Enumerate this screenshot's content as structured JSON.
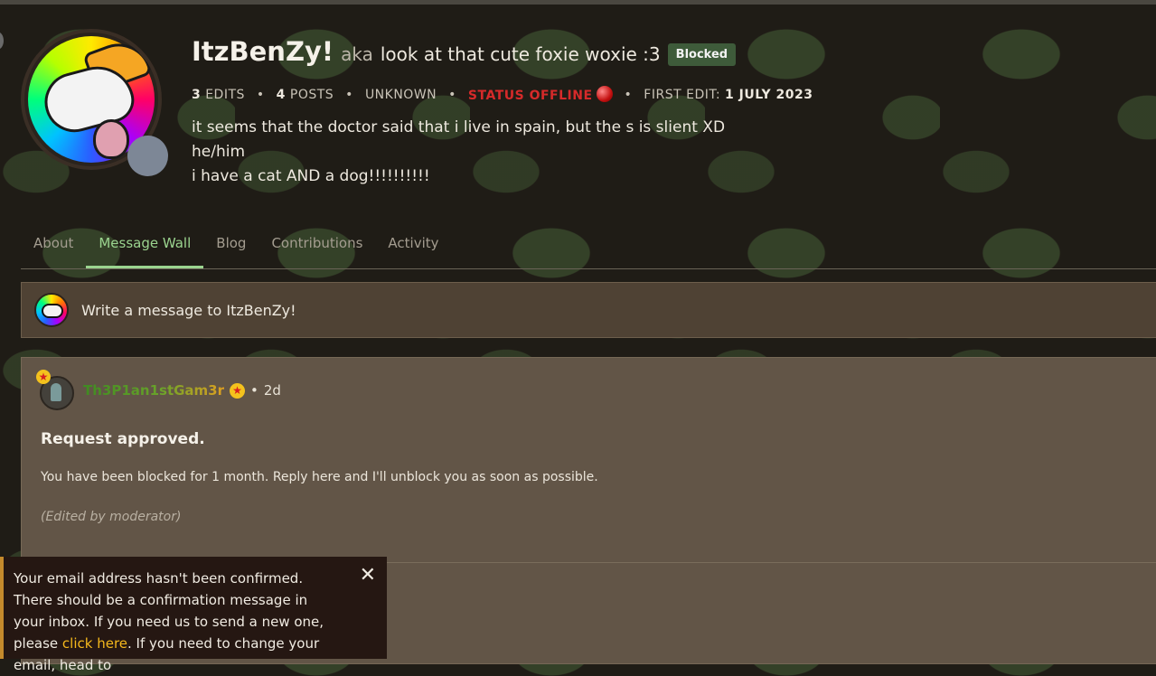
{
  "profile": {
    "username": "ItzBenZy!",
    "aka_label": "aka",
    "nickname": "look at that cute foxie woxie :3",
    "status_badge": "Blocked",
    "stats": {
      "edits_count": "3",
      "edits_label": "EDITS",
      "posts_count": "4",
      "posts_label": "POSTS",
      "unknown_label": "UNKNOWN",
      "status": "STATUS OFFLINE",
      "first_edit_label": "FIRST EDIT:",
      "first_edit_date": "1 JULY 2023"
    },
    "bio": [
      "it seems that the doctor said that i live in spain, but the s is slient XD",
      "he/him",
      "i have a cat AND a dog!!!!!!!!!!"
    ]
  },
  "tabs": [
    {
      "label": "About"
    },
    {
      "label": "Message Wall"
    },
    {
      "label": "Blog"
    },
    {
      "label": "Contributions"
    },
    {
      "label": "Activity"
    }
  ],
  "active_tab": "Message Wall",
  "compose": {
    "placeholder": "Write a message to ItzBenZy!"
  },
  "post": {
    "author": "Th3P1an1stGam3r",
    "separator": "•",
    "time": "2d",
    "title": "Request approved.",
    "body": "You have been blocked for 1 month. Reply here and I'll unblock you as soon as possible.",
    "edited_note": "(Edited by moderator)"
  },
  "toast": {
    "text_1": "Your email address hasn't been confirmed. There should be a confirmation message in your inbox. If you need us to send a new one, please ",
    "link_1": "click here",
    "text_2": ". If you need to change your email, head to",
    "close_glyph": "✕"
  },
  "colors": {
    "accent_tab": "#9bd48f",
    "status_offline": "#d62a2a",
    "blocked_badge": "#3e5b3a",
    "toast_link": "#f5b81c"
  },
  "icons": {
    "star_badge": "star-badge-icon",
    "close": "close-icon",
    "offline_indicator": "red-ball-icon"
  }
}
